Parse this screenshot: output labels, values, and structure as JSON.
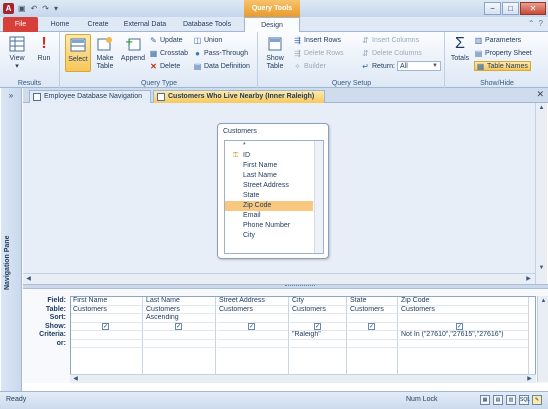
{
  "title_bar": {
    "app_icon_letter": "A",
    "qat_icons": [
      "save-icon",
      "undo-icon",
      "redo-icon",
      "customize-icon"
    ],
    "context_tab_label": "Query Tools",
    "window_buttons": [
      "−",
      "□",
      "✕"
    ]
  },
  "ribbon_tabs": {
    "file": "File",
    "home": "Home",
    "create": "Create",
    "external_data": "External Data",
    "database_tools": "Database Tools",
    "design": "Design"
  },
  "ribbon": {
    "results": {
      "label": "Results",
      "view": "View",
      "run": "Run"
    },
    "query_type": {
      "label": "Query Type",
      "select": "Select",
      "make_table": "Make\nTable",
      "append": "Append",
      "update": "Update",
      "crosstab": "Crosstab",
      "delete": "Delete",
      "union": "Union",
      "pass_through": "Pass-Through",
      "data_definition": "Data Definition"
    },
    "query_setup": {
      "label": "Query Setup",
      "show_table": "Show\nTable",
      "insert_rows": "Insert Rows",
      "delete_rows": "Delete Rows",
      "builder": "Builder",
      "insert_columns": "Insert Columns",
      "delete_columns": "Delete Columns",
      "return_label": "Return:",
      "return_value": "All"
    },
    "show_hide": {
      "label": "Show/Hide",
      "totals": "Totals",
      "parameters": "Parameters",
      "property_sheet": "Property Sheet",
      "table_names": "Table Names"
    }
  },
  "nav_pane": {
    "label": "Navigation Pane",
    "toggle": "»"
  },
  "document_tabs": [
    {
      "label": "Employee Database Navigation"
    },
    {
      "label": "Customers Who Live Nearby (Inner Raleigh)"
    }
  ],
  "table_box": {
    "title": "Customers",
    "fields": [
      "*",
      "ID",
      "First Name",
      "Last Name",
      "Street Address",
      "State",
      "Zip Code",
      "Email",
      "Phone Number",
      "City"
    ],
    "highlighted": "Zip Code"
  },
  "grid": {
    "row_labels": [
      "Field:",
      "Table:",
      "Sort:",
      "Show:",
      "Criteria:",
      "or:"
    ],
    "columns": [
      {
        "field": "First Name",
        "table": "Customers",
        "sort": "",
        "show": true,
        "criteria": ""
      },
      {
        "field": "Last Name",
        "table": "Customers",
        "sort": "Ascending",
        "show": true,
        "criteria": ""
      },
      {
        "field": "Street Address",
        "table": "Customers",
        "sort": "",
        "show": true,
        "criteria": ""
      },
      {
        "field": "City",
        "table": "Customers",
        "sort": "",
        "show": true,
        "criteria": "\"Raleigh\""
      },
      {
        "field": "State",
        "table": "Customers",
        "sort": "",
        "show": true,
        "criteria": ""
      },
      {
        "field": "Zip Code",
        "table": "Customers",
        "sort": "",
        "show": true,
        "criteria": "Not In (\"27610\",\"27615\",\"27616\")"
      }
    ]
  },
  "status_bar": {
    "left": "Ready",
    "num_lock": "Num Lock",
    "view_icons": [
      "datasheet-view-icon",
      "pivot-table-icon",
      "pivot-chart-icon",
      "sql-view-icon",
      "design-view-icon"
    ],
    "sql_text": "SQL"
  }
}
